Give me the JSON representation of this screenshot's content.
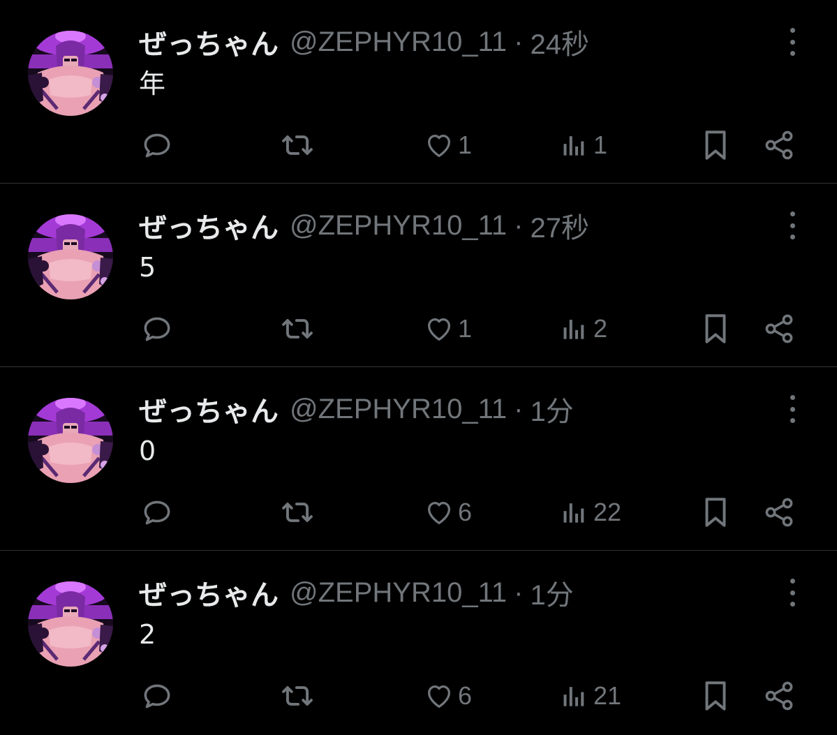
{
  "colors": {
    "background": "#000000",
    "text_primary": "#e7e9ea",
    "text_secondary": "#71767b",
    "divider": "#2f3336",
    "avatar_accent": "#b03ee0"
  },
  "icons": {
    "reply": "speech-bubble-icon",
    "retweet": "retweet-arrows-icon",
    "like": "heart-outline-icon",
    "views": "bar-chart-icon",
    "bookmark": "bookmark-icon",
    "share": "share-icon",
    "more": "vertical-ellipsis-icon"
  },
  "tweets": [
    {
      "author": {
        "display_name": "ぜっちゃん",
        "handle": "@ZEPHYR10_11"
      },
      "separator": "·",
      "time": "24秒",
      "text": "年",
      "counts": {
        "reply": "",
        "retweet": "",
        "like": "1",
        "views": "1"
      }
    },
    {
      "author": {
        "display_name": "ぜっちゃん",
        "handle": "@ZEPHYR10_11"
      },
      "separator": "·",
      "time": "27秒",
      "text": "5",
      "counts": {
        "reply": "",
        "retweet": "",
        "like": "1",
        "views": "2"
      }
    },
    {
      "author": {
        "display_name": "ぜっちゃん",
        "handle": "@ZEPHYR10_11"
      },
      "separator": "·",
      "time": "1分",
      "text": "0",
      "counts": {
        "reply": "",
        "retweet": "",
        "like": "6",
        "views": "22"
      }
    },
    {
      "author": {
        "display_name": "ぜっちゃん",
        "handle": "@ZEPHYR10_11"
      },
      "separator": "·",
      "time": "1分",
      "text": "2",
      "counts": {
        "reply": "",
        "retweet": "",
        "like": "6",
        "views": "21"
      }
    }
  ]
}
